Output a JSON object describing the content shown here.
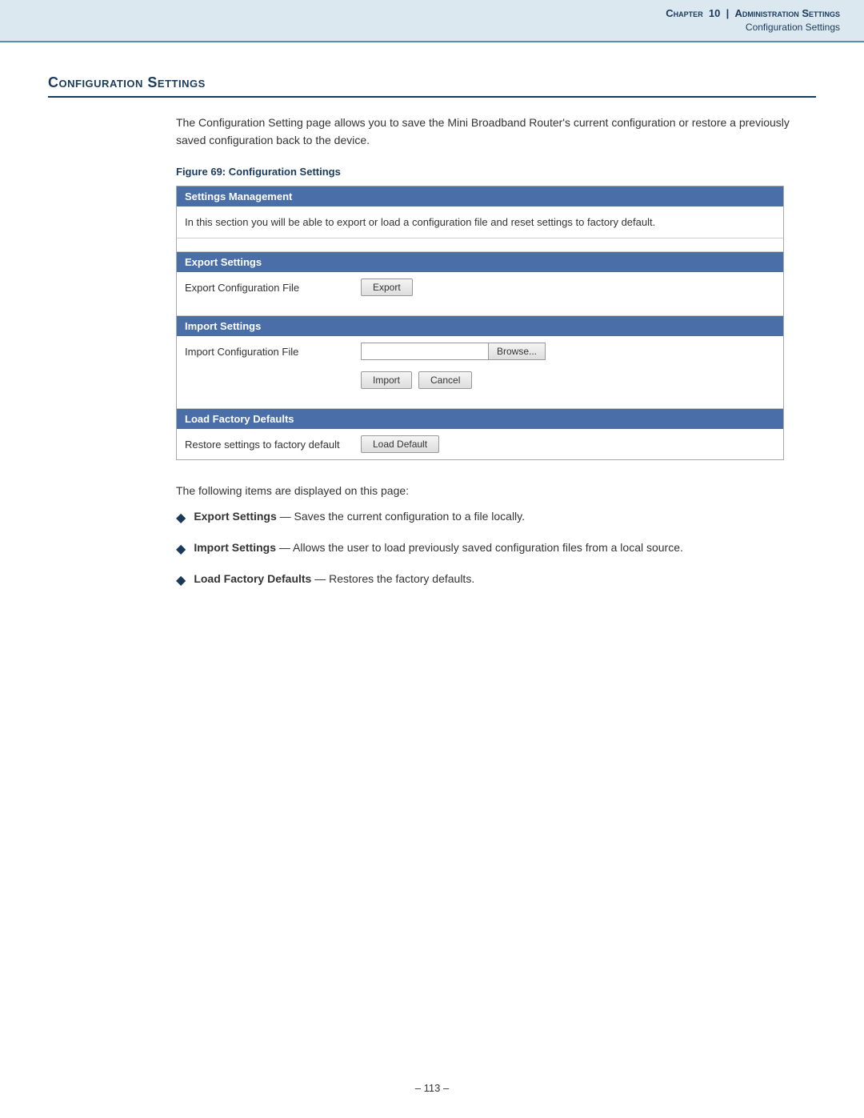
{
  "header": {
    "chapter_label": "Chapter",
    "chapter_number": "10",
    "separator": "|",
    "title": "Administration Settings",
    "subtitle": "Configuration Settings"
  },
  "section": {
    "title": "Configuration Settings",
    "intro": "The Configuration Setting page allows you to save the Mini Broadband Router's current configuration or restore a previously saved configuration back to the device.",
    "figure_caption": "Figure 69:  Configuration Settings"
  },
  "panel": {
    "settings_management": {
      "header": "Settings Management",
      "description": "In this section you will be able to export or load a configuration file and reset settings to factory default."
    },
    "export_settings": {
      "header": "Export Settings",
      "row_label": "Export Configuration File",
      "export_button": "Export"
    },
    "import_settings": {
      "header": "Import Settings",
      "row_label": "Import Configuration File",
      "browse_button": "Browse...",
      "import_button": "Import",
      "cancel_button": "Cancel"
    },
    "load_factory": {
      "header": "Load Factory Defaults",
      "row_label": "Restore settings to factory default",
      "load_button": "Load Default"
    }
  },
  "bullets": {
    "intro": "The following items are displayed on this page:",
    "items": [
      {
        "term": "Export Settings",
        "desc": " — Saves the current configuration to a file locally."
      },
      {
        "term": "Import Settings",
        "desc": " — Allows the user to load previously saved configuration files from a local source."
      },
      {
        "term": "Load Factory Defaults",
        "desc": " — Restores the factory defaults."
      }
    ]
  },
  "footer": {
    "page_number": "– 113 –"
  }
}
